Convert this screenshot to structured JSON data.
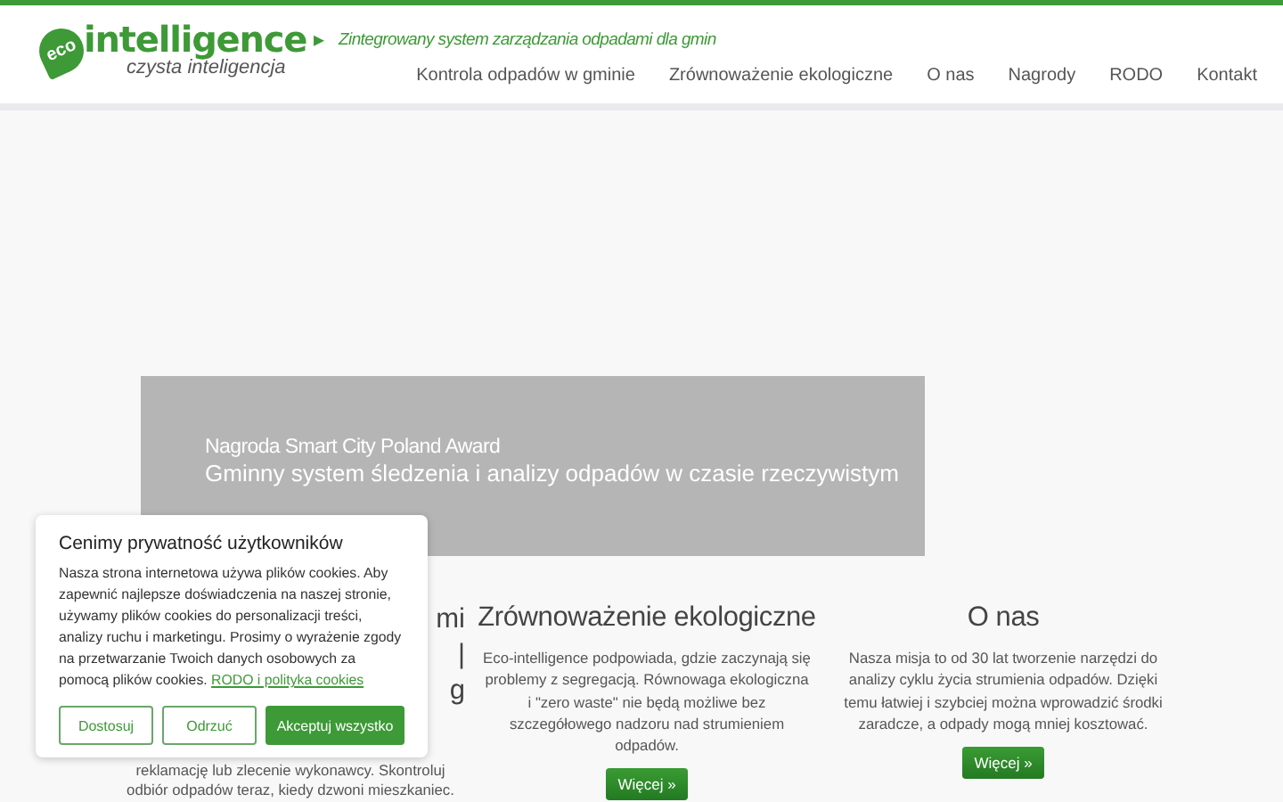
{
  "header": {
    "logo": {
      "badge": "eco",
      "name": "intelligence",
      "arrow": "▸",
      "subtitle": "czysta inteligencja"
    },
    "tagline": "Zintegrowany system zarządzania odpadami dla gmin",
    "nav": [
      {
        "label": "Kontrola odpadów w gminie"
      },
      {
        "label": "Zrównoważenie ekologiczne"
      },
      {
        "label": "O nas"
      },
      {
        "label": "Nagrody"
      },
      {
        "label": "RODO"
      },
      {
        "label": "Kontakt"
      }
    ]
  },
  "hero": {
    "kicker": "Nagroda Smart City Poland Award",
    "headline": "Gminny system śledzenia i analizy odpadów w czasie rzeczywistym"
  },
  "columns": [
    {
      "heading_lines": [
        "mi",
        "|",
        "g"
      ],
      "text_lines": [
        "reklamację lub zlecenie wykonawcy. Skontroluj",
        "odbiór odpadów teraz, kiedy dzwoni mieszkaniec."
      ]
    },
    {
      "heading": "Zrównoważenie ekologiczne",
      "text": "Eco-intelligence podpowiada, gdzie zaczynają się problemy z segregacją. Równowaga ekologiczna i \"zero waste\" nie będą możliwe bez szczegółowego nadzoru nad strumieniem odpadów.",
      "button": "Więcej »"
    },
    {
      "heading": "O nas",
      "text": "Nasza misja to od 30 lat tworzenie narzędzi do analizy cyklu życia strumienia odpadów. Dzięki temu łatwiej i szybciej można wprowadzić środki zaradcze, a odpady mogą mniej kosztować.",
      "button": "Więcej »"
    }
  ],
  "cookie_popup": {
    "title": "Cenimy prywatność użytkowników",
    "text": "Nasza strona internetowa używa plików cookies. Aby zapewnić najlepsze doświadczenia na naszej stronie, używamy plików cookies do personalizacji treści, analizy ruchu i marketingu. Prosimy o wyrażenie zgody na przetwarzanie Twoich danych osobowych za pomocą plików cookies.",
    "link": "RODO i polityka cookies",
    "buttons": [
      {
        "label": "Dostosuj",
        "kind": "outline"
      },
      {
        "label": "Odrzuć",
        "kind": "outline"
      },
      {
        "label": "Akceptuj wszystko",
        "kind": "primary"
      }
    ]
  }
}
